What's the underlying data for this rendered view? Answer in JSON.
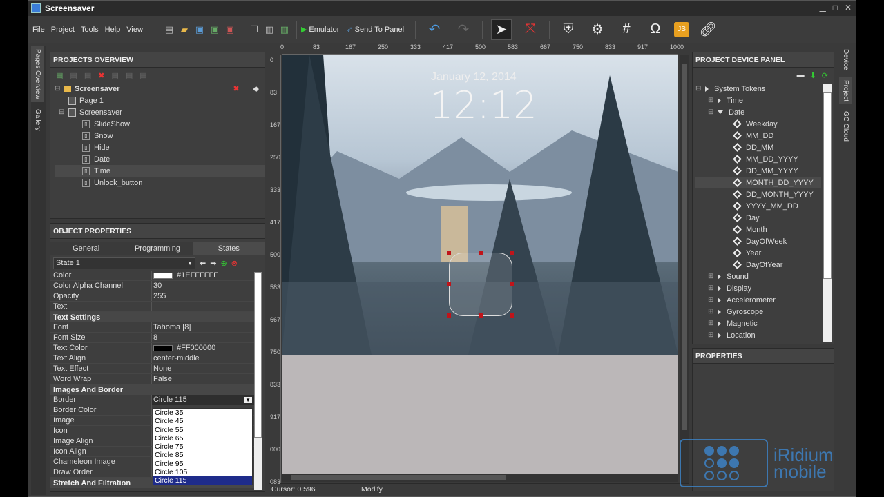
{
  "window": {
    "title": "Screensaver"
  },
  "menu": [
    "File",
    "Project",
    "Tools",
    "Help",
    "View"
  ],
  "toolbar": {
    "emulator": "Emulator",
    "send_to_panel": "Send To Panel",
    "js": "JS"
  },
  "left_tabs": [
    "Pages Overview",
    "Gallery"
  ],
  "right_tabs": [
    "Device",
    "Project",
    "GC Cloud"
  ],
  "projects": {
    "title": "PROJECTS OVERVIEW",
    "root": "Screensaver",
    "pages": [
      "Page 1",
      "Screensaver"
    ],
    "items": [
      "SlideShow",
      "Snow",
      "Hide",
      "Date",
      "Time",
      "Unlock_button"
    ]
  },
  "object_props": {
    "title": "OBJECT PROPERTIES",
    "tabs": [
      "General",
      "Programming",
      "States"
    ],
    "state": "State 1",
    "rows": [
      {
        "name": "Color",
        "value": "#1EFFFFFF",
        "swatch": "#ffffff"
      },
      {
        "name": "Color Alpha Channel",
        "value": "30"
      },
      {
        "name": "Opacity",
        "value": "255"
      },
      {
        "name": "Text",
        "value": ""
      }
    ],
    "sec_text": "Text Settings",
    "text_rows": [
      {
        "name": "Font",
        "value": "Tahoma [8]"
      },
      {
        "name": "Font Size",
        "value": "8"
      },
      {
        "name": "Text Color",
        "value": "#FF000000",
        "swatch": "#000000"
      },
      {
        "name": "Text Align",
        "value": "center-middle"
      },
      {
        "name": "Text Effect",
        "value": "None"
      },
      {
        "name": "Word Wrap",
        "value": "False"
      }
    ],
    "sec_images": "Images And Border",
    "img_rows": [
      {
        "name": "Border",
        "value": "Circle 115"
      },
      {
        "name": "Border Color",
        "value": ""
      },
      {
        "name": "Image",
        "value": ""
      },
      {
        "name": "Icon",
        "value": ""
      },
      {
        "name": "Image Align",
        "value": ""
      },
      {
        "name": "Icon Align",
        "value": ""
      },
      {
        "name": "Chameleon Image",
        "value": ""
      },
      {
        "name": "Draw Order",
        "value": ""
      }
    ],
    "sec_stretch": "Stretch And Filtration",
    "dropdown": [
      "Circle 35",
      "Circle 45",
      "Circle 55",
      "Circle 65",
      "Circle 75",
      "Circle 85",
      "Circle 95",
      "Circle 105",
      "Circle 115"
    ]
  },
  "ruler_h": [
    "0",
    "83",
    "167",
    "250",
    "333",
    "417",
    "500",
    "583",
    "667",
    "750",
    "833",
    "917",
    "1000"
  ],
  "ruler_v": [
    "0",
    "83",
    "167",
    "250",
    "333",
    "417",
    "500",
    "583",
    "667",
    "750",
    "833",
    "917",
    "000",
    "083"
  ],
  "canvas": {
    "date": "January 12, 2014",
    "time": "12:12"
  },
  "status": {
    "cursor": "Cursor: 0:596",
    "mode": "Modify"
  },
  "device_panel": {
    "title": "PROJECT DEVICE PANEL",
    "root": "System Tokens",
    "time": "Time",
    "date": "Date",
    "date_items": [
      "Weekday",
      "MM_DD",
      "DD_MM",
      "MM_DD_YYYY",
      "DD_MM_YYYY",
      "MONTH_DD_YYYY",
      "DD_MONTH_YYYY",
      "YYYY_MM_DD",
      "Day",
      "Month",
      "DayOfWeek",
      "Year",
      "DayOfYear"
    ],
    "groups": [
      "Sound",
      "Display",
      "Accelerometer",
      "Gyroscope",
      "Magnetic",
      "Location"
    ]
  },
  "properties": {
    "title": "PROPERTIES"
  },
  "brand": {
    "line1": "iRidium",
    "line2": "mobile"
  }
}
